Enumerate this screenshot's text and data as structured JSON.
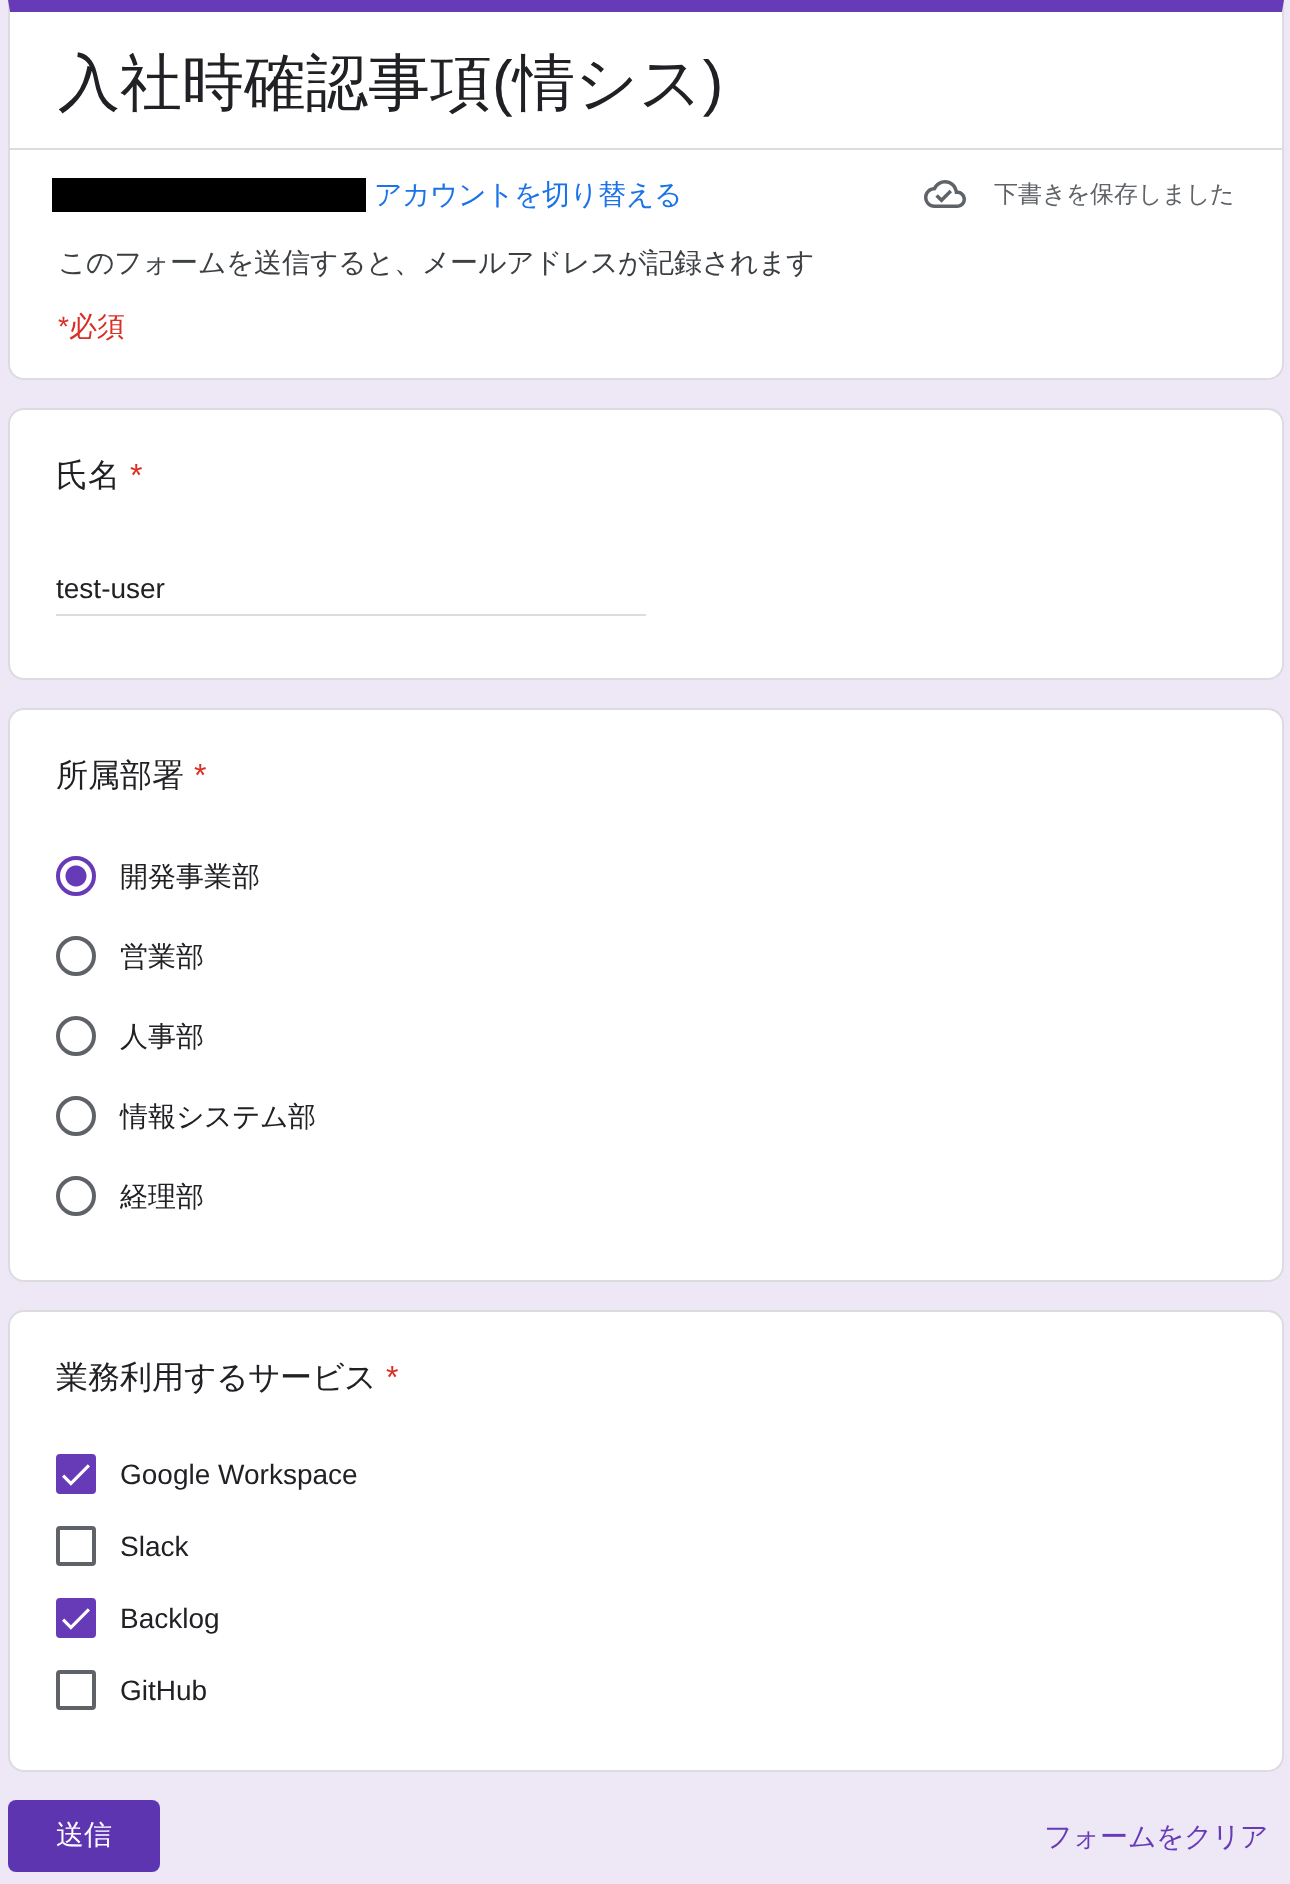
{
  "header": {
    "title": "入社時確認事項(情シス)",
    "switch_account_link": "アカウントを切り替える",
    "draft_status": "下書きを保存しました",
    "email_notice": "このフォームを送信すると、メールアドレスが記録されます",
    "required_note": "*必須"
  },
  "questions": [
    {
      "kind": "text",
      "title": "氏名",
      "required_mark": "*",
      "value": "test-user"
    },
    {
      "kind": "radio",
      "title": "所属部署",
      "required_mark": "*",
      "options": [
        {
          "label": "開発事業部",
          "selected": true
        },
        {
          "label": "営業部",
          "selected": false
        },
        {
          "label": "人事部",
          "selected": false
        },
        {
          "label": "情報システム部",
          "selected": false
        },
        {
          "label": "経理部",
          "selected": false
        }
      ]
    },
    {
      "kind": "checkbox",
      "title": "業務利用するサービス",
      "required_mark": "*",
      "options": [
        {
          "label": "Google Workspace",
          "checked": true
        },
        {
          "label": "Slack",
          "checked": false
        },
        {
          "label": "Backlog",
          "checked": true
        },
        {
          "label": "GitHub",
          "checked": false
        }
      ]
    }
  ],
  "footer": {
    "submit_button": "送信",
    "clear_link": "フォームをクリア"
  }
}
